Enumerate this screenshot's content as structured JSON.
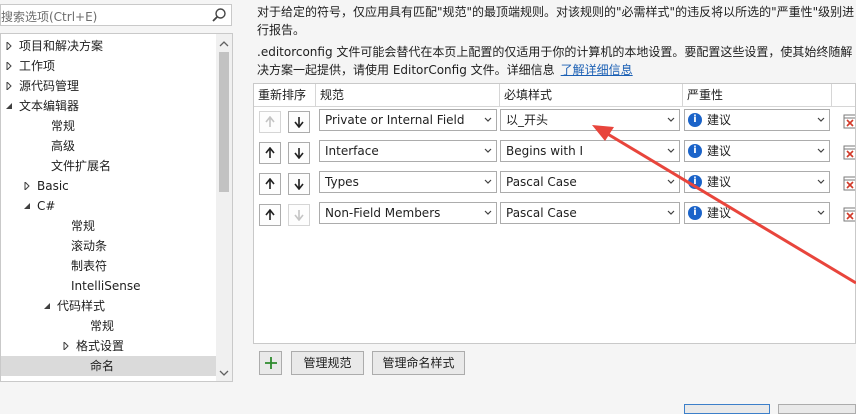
{
  "search": {
    "placeholder": "搜索选项(Ctrl+E)"
  },
  "tree": {
    "items": [
      {
        "label": "项目和解决方案",
        "expanded": false,
        "selected": false
      },
      {
        "label": "工作项",
        "expanded": false,
        "selected": false
      },
      {
        "label": "源代码管理",
        "expanded": false,
        "selected": false
      },
      {
        "label": "文本编辑器",
        "expanded": true,
        "selected": false
      },
      {
        "label": "常规",
        "selected": false
      },
      {
        "label": "高级",
        "selected": false
      },
      {
        "label": "文件扩展名",
        "selected": false
      },
      {
        "label": "Basic",
        "expanded": false,
        "selected": false
      },
      {
        "label": "C#",
        "expanded": true,
        "selected": false
      },
      {
        "label": "常规",
        "selected": false
      },
      {
        "label": "滚动条",
        "selected": false
      },
      {
        "label": "制表符",
        "selected": false
      },
      {
        "label": "IntelliSense",
        "selected": false
      },
      {
        "label": "代码样式",
        "expanded": true,
        "selected": false
      },
      {
        "label": "常规",
        "selected": false
      },
      {
        "label": "格式设置",
        "expanded": false,
        "selected": false
      },
      {
        "label": "命名",
        "selected": true
      }
    ]
  },
  "description": {
    "line1": "对于给定的符号，仅应用具有匹配\"规范\"的最顶端规则。对该规则的\"必需样式\"的违反将以所选的\"严重性\"级别进",
    "line2": "行报告。",
    "line3": ".editorconfig 文件可能会替代在本页上配置的仅适用于你的计算机的本地设置。要配置这些设置，使其始终随解",
    "line4": "决方案一起提供，请使用 EditorConfig 文件。详细信息",
    "link": "了解详细信息"
  },
  "grid": {
    "columns": [
      "重新排序",
      "规范",
      "必填样式",
      "严重性"
    ],
    "rows": [
      {
        "up_enabled": false,
        "down_enabled": true,
        "spec": "Private or Internal Field",
        "style": "以_开头",
        "severity": "建议"
      },
      {
        "up_enabled": true,
        "down_enabled": true,
        "spec": "Interface",
        "style": "Begins with I",
        "severity": "建议"
      },
      {
        "up_enabled": true,
        "down_enabled": true,
        "spec": "Types",
        "style": "Pascal Case",
        "severity": "建议"
      },
      {
        "up_enabled": true,
        "down_enabled": false,
        "spec": "Non-Field Members",
        "style": "Pascal Case",
        "severity": "建议"
      }
    ]
  },
  "buttons": {
    "manage_specs": "管理规范",
    "manage_styles": "管理命名样式"
  },
  "colors": {
    "annotation_arrow": "#e8453c",
    "link": "#1a5fb4",
    "info_icon": "#1a63c9",
    "add_icon": "#2e8b2e"
  }
}
